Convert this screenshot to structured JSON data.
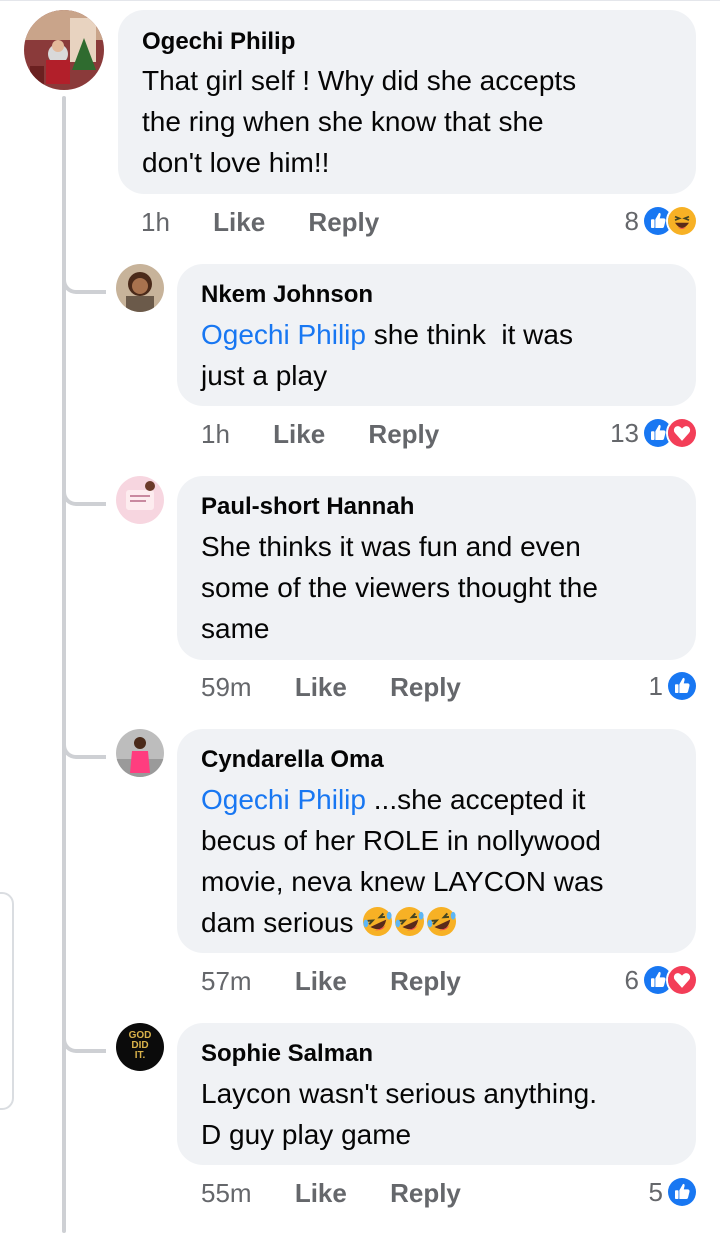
{
  "comments": [
    {
      "name": "Ogechi Philip",
      "lines": [
        [
          {
            "t": "That girl self ! Why did she accepts"
          }
        ],
        [
          {
            "t": "the ring when she know that she"
          }
        ],
        [
          {
            "t": "don't love him!!"
          }
        ]
      ],
      "time": "1h",
      "like": "Like",
      "reply": "Reply",
      "reaction_count": "8",
      "reactions": [
        "like-icon",
        "haha-icon"
      ]
    },
    {
      "name": "Nkem Johnson",
      "lines": [
        [
          {
            "t": "Ogechi Philip",
            "mention": true
          },
          {
            "t": " she think  it was"
          }
        ],
        [
          {
            "t": "just a play"
          }
        ]
      ],
      "time": "1h",
      "like": "Like",
      "reply": "Reply",
      "reaction_count": "13",
      "reactions": [
        "like-icon",
        "love-icon"
      ]
    },
    {
      "name": "Paul-short Hannah",
      "lines": [
        [
          {
            "t": "She thinks it was fun and even"
          }
        ],
        [
          {
            "t": "some of the viewers thought the"
          }
        ],
        [
          {
            "t": "same"
          }
        ]
      ],
      "time": "59m",
      "like": "Like",
      "reply": "Reply",
      "reaction_count": "1",
      "reactions": [
        "like-icon"
      ]
    },
    {
      "name": "Cyndarella Oma",
      "lines": [
        [
          {
            "t": "Ogechi Philip",
            "mention": true
          },
          {
            "t": " ...she accepted it"
          }
        ],
        [
          {
            "t": "becus of her ROLE in nollywood"
          }
        ],
        [
          {
            "t": "movie, neva knew LAYCON was"
          }
        ],
        [
          {
            "t": "dam serious "
          },
          {
            "emoji": "rofl-emoji"
          },
          {
            "emoji": "rofl-emoji"
          },
          {
            "emoji": "rofl-emoji"
          }
        ]
      ],
      "time": "57m",
      "like": "Like",
      "reply": "Reply",
      "reaction_count": "6",
      "reactions": [
        "like-icon",
        "love-icon"
      ]
    },
    {
      "name": "Sophie Salman",
      "lines": [
        [
          {
            "t": "Laycon wasn't serious anything."
          }
        ],
        [
          {
            "t": "D guy play game"
          }
        ]
      ],
      "time": "55m",
      "like": "Like",
      "reply": "Reply",
      "reaction_count": "5",
      "reactions": [
        "like-icon"
      ]
    }
  ],
  "avatar_badges": {
    "sophie": [
      "GOD",
      "DID",
      "IT."
    ]
  },
  "colors": {
    "bubble": "#f0f2f5",
    "mention": "#1877f2",
    "meta": "#65676b",
    "like": "#1877f2",
    "love": "#f33e58",
    "haha": "#f7b125"
  }
}
